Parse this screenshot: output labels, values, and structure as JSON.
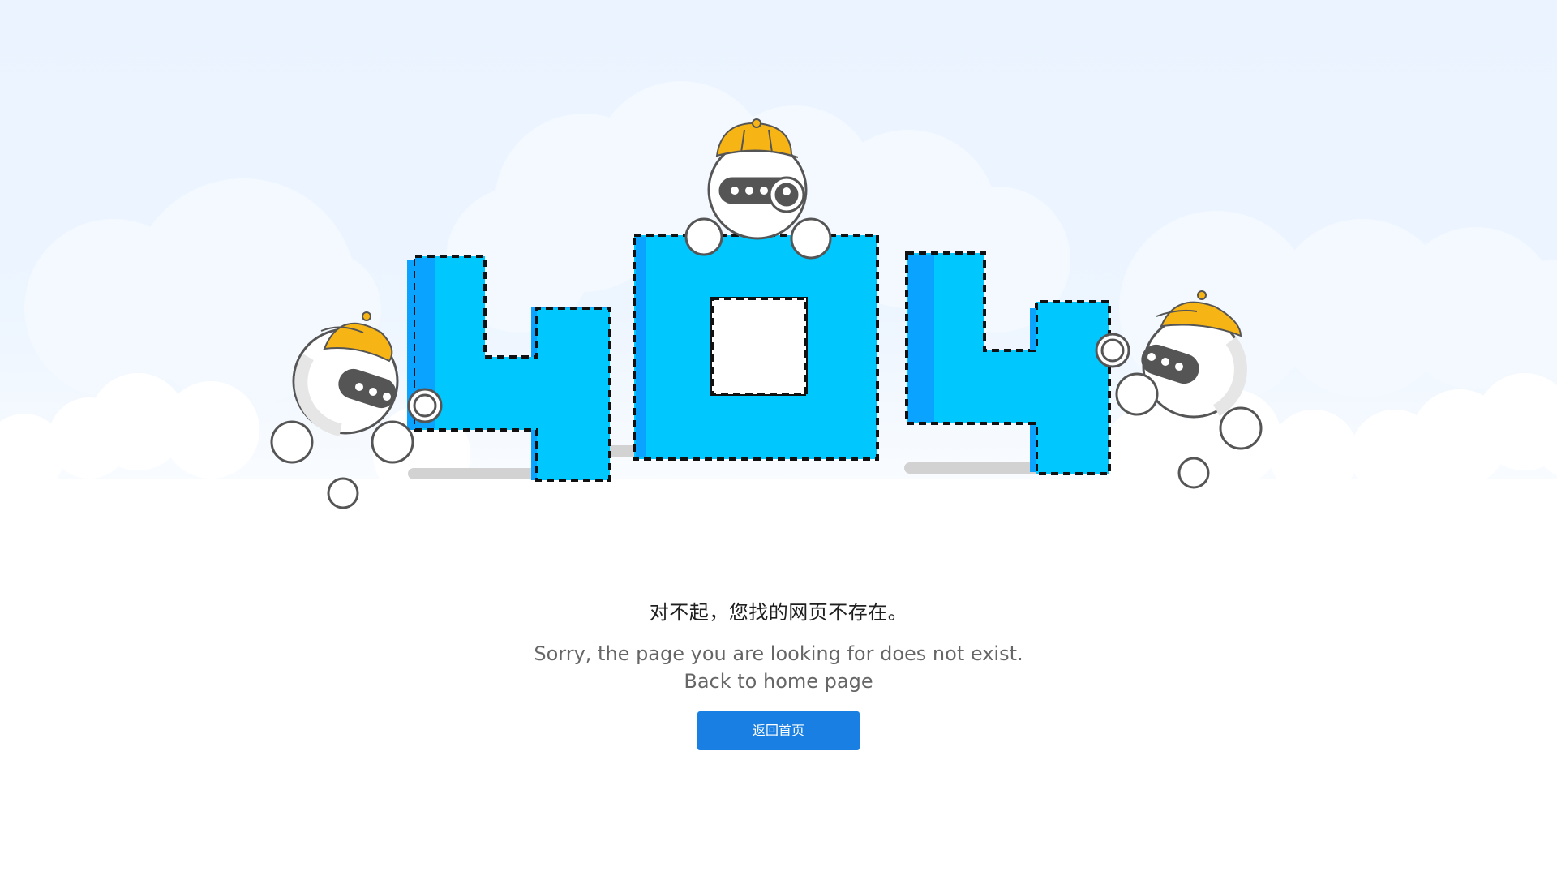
{
  "illustration": {
    "digits": [
      "4",
      "0",
      "4"
    ],
    "colors": {
      "sky_top": "#e9f3ff",
      "cloud": "#ffffff",
      "digit_fill": "#00c8fe",
      "digit_side": "#0aa3ff",
      "digit_outline": "#111111",
      "robot_body": "#ffffff",
      "robot_outline": "#555555",
      "visor": "#555555",
      "hat": "#f7b515",
      "shadow": "#cfcfcf"
    },
    "icons": [
      "robot-left",
      "robot-top",
      "robot-right",
      "magnifier-icon",
      "hat-icon"
    ]
  },
  "message": {
    "chinese": "对不起，您找的网页不存在。",
    "english": "Sorry, the page you are looking for does not exist.",
    "back_text": "Back to home page"
  },
  "home_button": {
    "label": "返回首页",
    "color": "#1a7fe3"
  }
}
